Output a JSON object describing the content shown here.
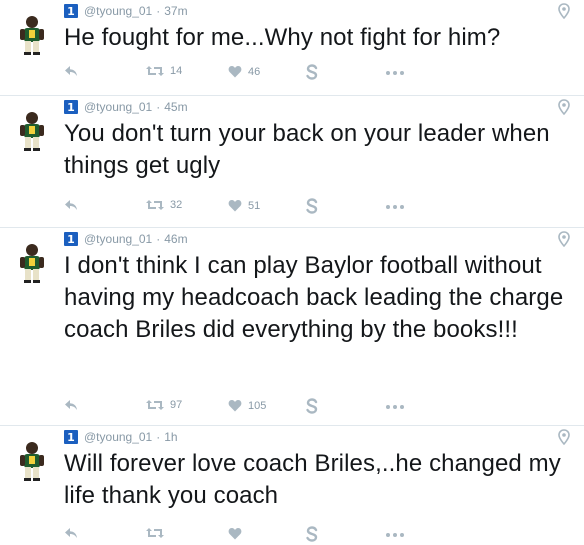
{
  "colors": {
    "badge": "#1b5fbf",
    "meta": "#8899a6",
    "text": "#14171a",
    "divider": "#e1e8ed",
    "action_icon": "#aab8c2"
  },
  "tweets": [
    {
      "handle": "@tyoung_01",
      "time": "37m",
      "badge": "1",
      "text": "He fought for me...Why not fight for him?",
      "retweets": "14",
      "likes": "46"
    },
    {
      "handle": "@tyoung_01",
      "time": "45m",
      "badge": "1",
      "text": "You don't turn your back on your leader when things get ugly",
      "retweets": "32",
      "likes": "51"
    },
    {
      "handle": "@tyoung_01",
      "time": "46m",
      "badge": "1",
      "text": "I don't think I can play Baylor football without having my headcoach back leading the charge coach Briles did everything by the books!!!",
      "retweets": "97",
      "likes": "105"
    },
    {
      "handle": "@tyoung_01",
      "time": "1h",
      "badge": "1",
      "text": "Will forever love coach Briles,..he changed my life thank you coach",
      "retweets": "",
      "likes": ""
    }
  ],
  "separator": "·",
  "icons": {
    "avatar": "player-avatar",
    "reply": "reply-icon",
    "retweet": "retweet-icon",
    "like": "heart-icon",
    "share": "vine-s-icon",
    "more": "more-dots-icon",
    "location": "location-pin-icon"
  }
}
